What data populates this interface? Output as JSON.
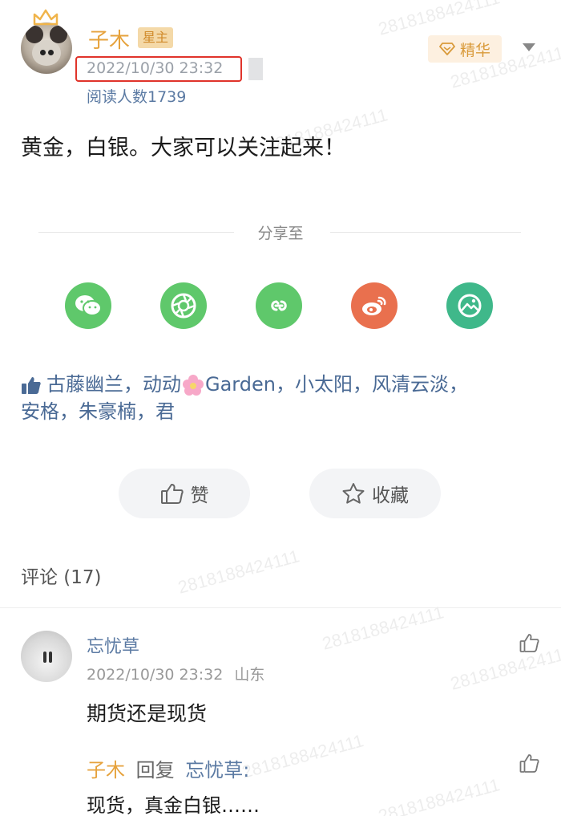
{
  "post": {
    "author": "子木",
    "role_badge": "星主",
    "featured_label": "精华",
    "timestamp": "2022/10/30 23:32",
    "read_count": "阅读人数1739",
    "content": "黄金，白银。大家可以关注起来！"
  },
  "share": {
    "title": "分享至",
    "targets": [
      "wechat-icon",
      "moments-icon",
      "mini-program-icon",
      "weibo-icon",
      "album-icon"
    ],
    "colors": [
      "#5fc86b",
      "#5fc86b",
      "#5fc86b",
      "#e9704e",
      "#3fb88a"
    ]
  },
  "likes": {
    "line1_before_flower": "古藤幽兰，动动",
    "line1_after_flower": "Garden，小太阳，风清云淡，",
    "line2": "安格，朱豪楠，君"
  },
  "actions": {
    "like_label": "赞",
    "favorite_label": "收藏"
  },
  "comments": {
    "header": "评论 (17)",
    "items": [
      {
        "name": "忘忧草",
        "time": "2022/10/30 23:32",
        "location": "山东",
        "text": "期货还是现货",
        "reply": {
          "from": "子木",
          "verb": "回复",
          "to": "忘忧草:",
          "text": "现货，真金白银……"
        }
      }
    ]
  },
  "watermark": "2818188424111"
}
